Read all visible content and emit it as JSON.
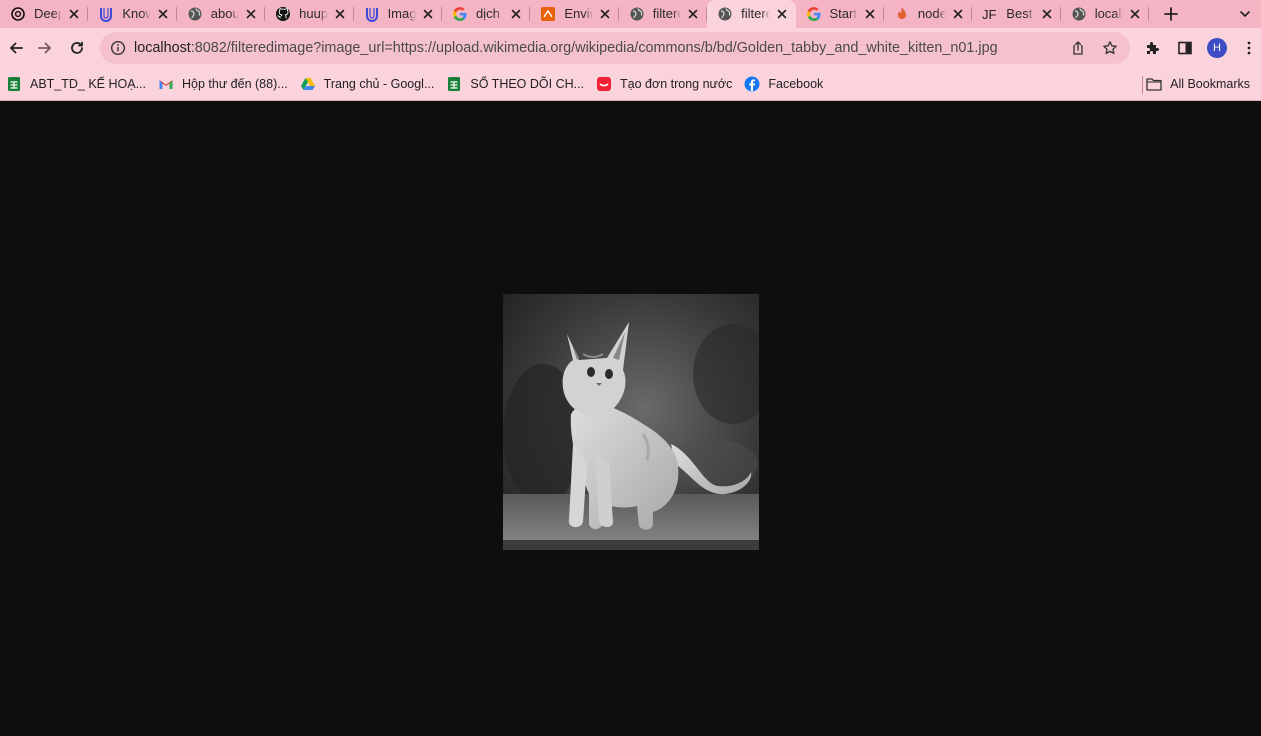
{
  "tabs": [
    {
      "title": "DeepL Translate",
      "icon": "openai-icon",
      "active": false
    },
    {
      "title": "Knowledge",
      "icon": "udacity-icon",
      "active": false
    },
    {
      "title": "about",
      "icon": "globe-icon",
      "active": false
    },
    {
      "title": "huuphuoc",
      "icon": "github-icon",
      "active": false
    },
    {
      "title": "Image Filter",
      "icon": "udacity-icon",
      "active": false
    },
    {
      "title": "dịch",
      "icon": "google-icon",
      "active": false
    },
    {
      "title": "Environment",
      "icon": "aws-icon",
      "active": false
    },
    {
      "title": "filteredimage",
      "icon": "globe-icon",
      "active": false
    },
    {
      "title": "filteredimage",
      "icon": "globe-icon",
      "active": true
    },
    {
      "title": "Start",
      "icon": "google-icon",
      "active": false
    },
    {
      "title": "node",
      "icon": "flame-icon",
      "active": false
    },
    {
      "title": "Best",
      "icon": "jf-icon",
      "active": false
    },
    {
      "title": "localhost",
      "icon": "globe-icon",
      "active": false
    }
  ],
  "toolbar": {
    "url_host": "localhost",
    "url_rest": ":8082/filteredimage?image_url=https://upload.wikimedia.org/wikipedia/commons/b/bd/Golden_tabby_and_white_kitten_n01.jpg",
    "profile_initial": "H"
  },
  "bookmarks": [
    {
      "label": "ABT_TD_ KẾ HOẠ...",
      "icon": "sheets-icon"
    },
    {
      "label": "Hộp thư đến (88)...",
      "icon": "gmail-icon"
    },
    {
      "label": "Trang chủ - Googl...",
      "icon": "drive-icon"
    },
    {
      "label": "SỔ THEO DÕI CH...",
      "icon": "sheets-icon"
    },
    {
      "label": "Tạo đơn trong nước",
      "icon": "shop-icon"
    },
    {
      "label": "Facebook",
      "icon": "facebook-icon"
    }
  ],
  "all_bookmarks_label": "All Bookmarks",
  "colors": {
    "tab_strip": "#f5b4c4",
    "toolbar": "#fbd3dd",
    "page_background": "#0e0e0e"
  },
  "page": {
    "image_alt": "Golden tabby and white kitten (greyscale filtered)"
  }
}
